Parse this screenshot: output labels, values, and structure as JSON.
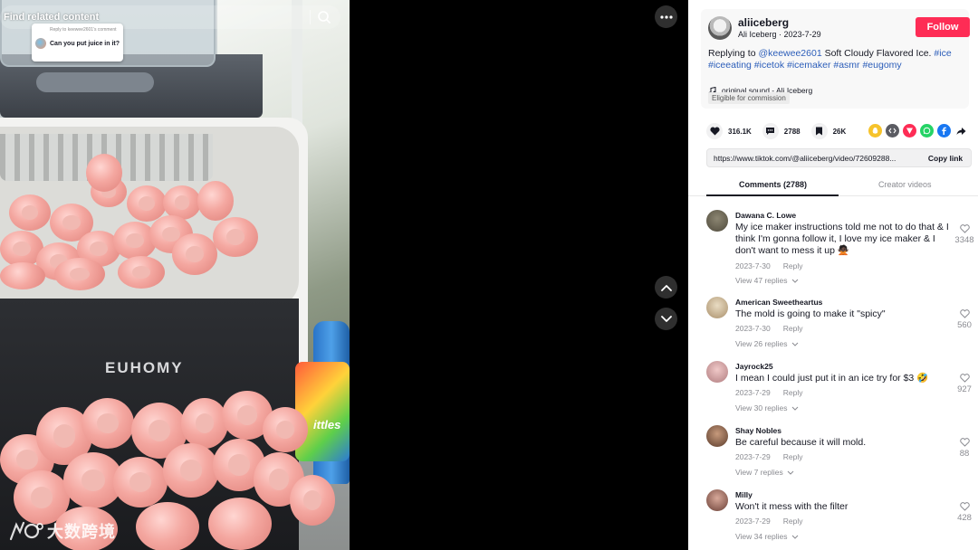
{
  "video": {
    "search_placeholder": "Find related content",
    "reply_bubble": {
      "small": "Reply to keewee2601's comment",
      "question": "Can you put juice in it?"
    },
    "brand": "EUHOMY",
    "bottle_label": "ittles",
    "watermark": "大数跨境"
  },
  "author": {
    "username": "aliiceberg",
    "display_name": "Ali Iceberg",
    "date": "2023-7-29",
    "follow_label": "Follow"
  },
  "description": {
    "prefix": "Replying to ",
    "mention": "@keewee2601",
    "body": " Soft Cloudy Flavored Ice. ",
    "tags": [
      "#ice",
      "#iceeating",
      "#icetok",
      "#icemaker",
      "#asmr",
      "#eugomy"
    ]
  },
  "sound": "original sound - Ali Iceberg",
  "eligible": "Eligible for commission",
  "actions": {
    "likes": "316.1K",
    "comments": "2788",
    "saves": "26K"
  },
  "share_icons": [
    {
      "name": "snapchat-share-icon",
      "color": "#f6c32b"
    },
    {
      "name": "embed-share-icon",
      "color": "#5b5c63"
    },
    {
      "name": "send-share-icon",
      "color": "#fe2c55"
    },
    {
      "name": "whatsapp-share-icon",
      "color": "#25d366"
    },
    {
      "name": "facebook-share-icon",
      "color": "#1877f2"
    },
    {
      "name": "forward-share-icon",
      "color": "#161823"
    }
  ],
  "link": {
    "url": "https://www.tiktok.com/@aliiceberg/video/72609288...",
    "copy_label": "Copy link"
  },
  "tabs": {
    "comments": "Comments (2788)",
    "creator": "Creator videos"
  },
  "comments": [
    {
      "name": "Dawana C. Lowe",
      "text": "My ice maker instructions told me not to do that & I think I'm gonna follow it, I love my ice maker & I don't want to mess it up 🙅🏿",
      "date": "2023-7-30",
      "reply": "Reply",
      "replies": "View 47 replies",
      "likes": "3348"
    },
    {
      "name": "American Sweetheartus",
      "text": "The mold is going to make it \"spicy\"",
      "date": "2023-7-30",
      "reply": "Reply",
      "replies": "View 26 replies",
      "likes": "560"
    },
    {
      "name": "Jayrock25",
      "text": "I mean I could just put it in an ice try for $3 🤣",
      "date": "2023-7-29",
      "reply": "Reply",
      "replies": "View 30 replies",
      "likes": "927"
    },
    {
      "name": "Shay Nobles",
      "text": "Be careful because it will mold.",
      "date": "2023-7-29",
      "reply": "Reply",
      "replies": "View 7 replies",
      "likes": "88"
    },
    {
      "name": "Milly",
      "text": "Won't it mess with the filter",
      "date": "2023-7-29",
      "reply": "Reply",
      "replies": "View 34 replies",
      "likes": "428"
    }
  ]
}
